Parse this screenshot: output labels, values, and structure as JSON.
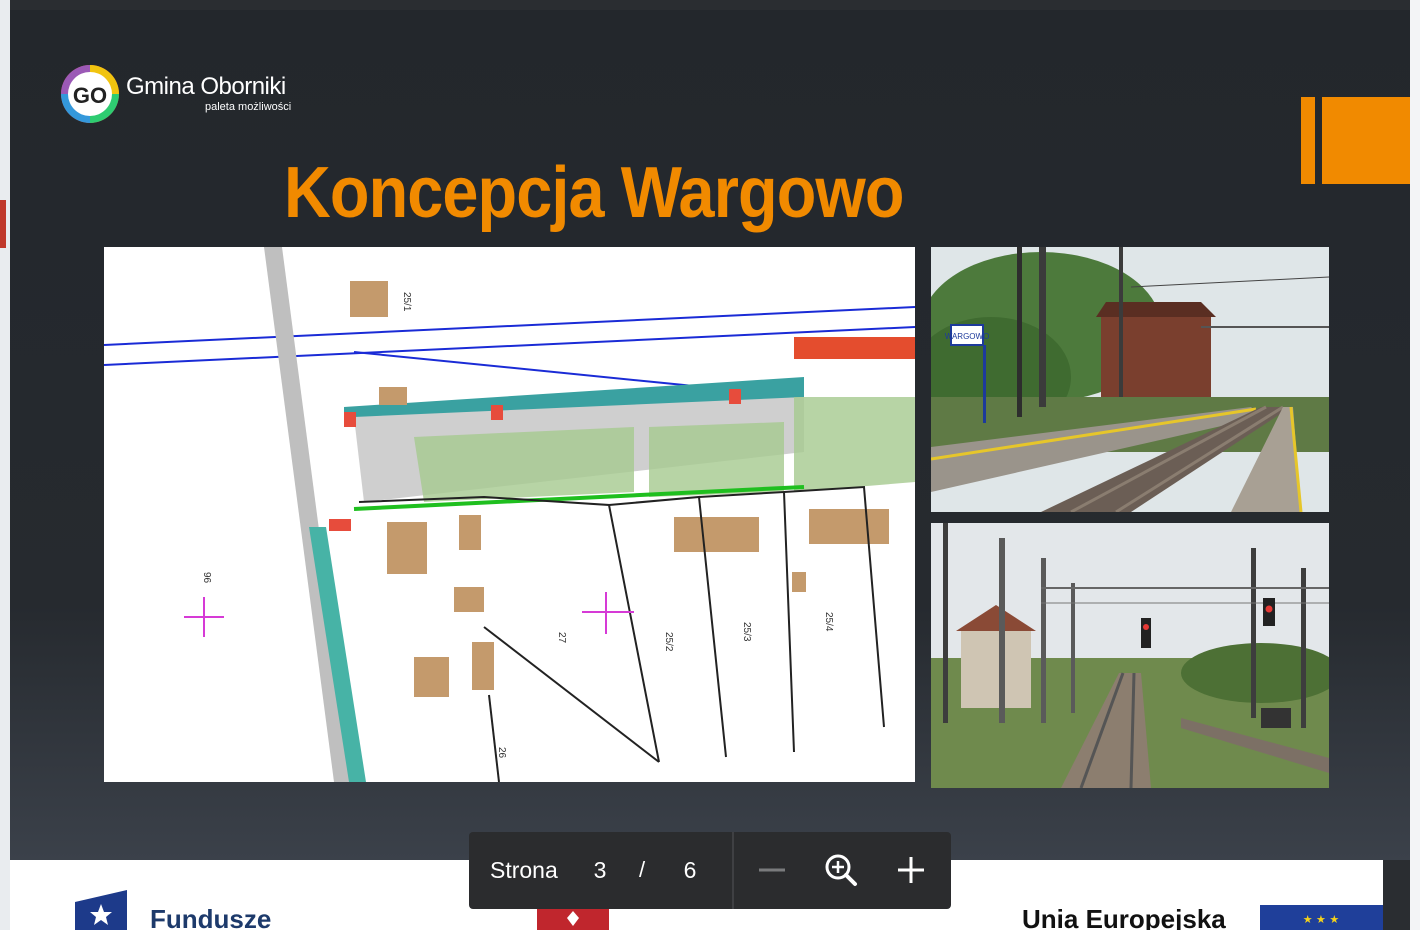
{
  "slide": {
    "logo_text": "Gmina Oborniki",
    "logo_subtitle": "paleta możliwości",
    "logo_badge": "GO",
    "title": "Koncepcja Wargowo",
    "accent_color": "#f18a00"
  },
  "plan": {
    "labels": [
      "25/1",
      "27",
      "25/2",
      "25/3",
      "25/4",
      "26",
      "96"
    ]
  },
  "photos": {
    "station_sign": "WARGOWO"
  },
  "footer": {
    "left_text": "Fundusze",
    "right_text": "Unia Europejska"
  },
  "viewer": {
    "page_label": "Strona",
    "current_page": "3",
    "separator": "/",
    "total_pages": "6",
    "zoom_out_icon": "minus-icon",
    "zoom_icon": "zoom-icon",
    "zoom_in_icon": "plus-icon"
  }
}
